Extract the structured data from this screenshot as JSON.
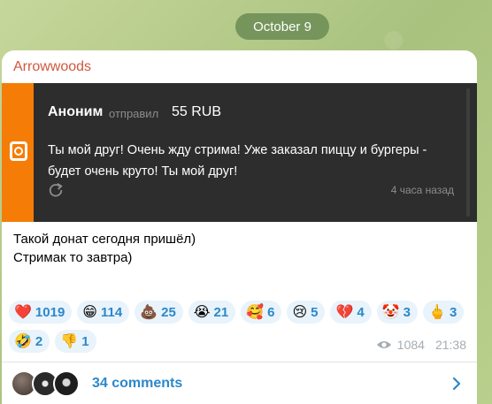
{
  "date_label": "October 9",
  "post": {
    "author": "Arrowwoods",
    "donation": {
      "name": "Аноним",
      "action": "отправил",
      "amount": "55 RUB",
      "message": "Ты мой друг! Очень жду стрима! Уже заказал пиццу и бургеры - будет очень круто! Ты мой друг!",
      "time_ago": "4 часа назад"
    },
    "caption_line1": "Такой донат сегодня пришёл)",
    "caption_line2": "Стримак то завтра)",
    "reactions": [
      {
        "emoji": "❤️",
        "count": "1019"
      },
      {
        "emoji": "😁",
        "count": "114"
      },
      {
        "emoji": "💩",
        "count": "25"
      },
      {
        "emoji": "😭",
        "count": "21"
      },
      {
        "emoji": "🥰",
        "count": "6"
      },
      {
        "emoji": "😢",
        "count": "5"
      },
      {
        "emoji": "💔",
        "count": "4"
      },
      {
        "emoji": "🤡",
        "count": "3"
      },
      {
        "emoji": "🖕",
        "count": "3"
      },
      {
        "emoji": "🤣",
        "count": "2"
      },
      {
        "emoji": "👎",
        "count": "1"
      }
    ],
    "views": "1084",
    "time": "21:38",
    "comments_label": "34 comments"
  },
  "colors": {
    "author": "#d0573e",
    "accent": "#2c88c9",
    "donation_stripe": "#f57d07",
    "reaction_bg": "#e8f3fb"
  }
}
